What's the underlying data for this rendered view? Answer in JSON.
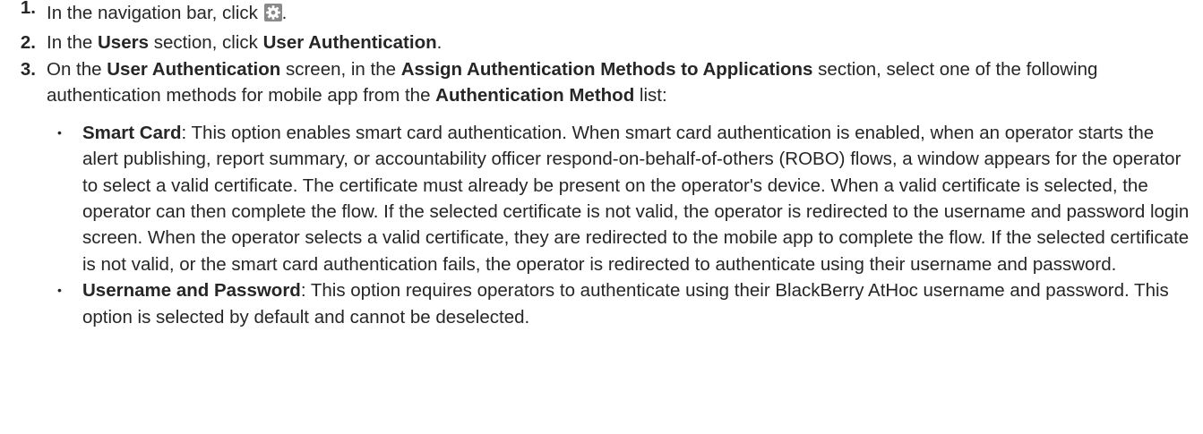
{
  "steps": [
    {
      "number": "1.",
      "text_before": "In the navigation bar, click ",
      "icon": "gear-icon",
      "text_after": "."
    },
    {
      "number": "2.",
      "t1": "In the ",
      "b1": "Users",
      "t2": " section, click ",
      "b2": "User Authentication",
      "t3": "."
    },
    {
      "number": "3.",
      "t1": "On the ",
      "b1": "User Authentication",
      "t2": " screen, in the ",
      "b2": "Assign Authentication Methods to Applications",
      "t3": " section, select one of the following authentication methods for mobile app from the ",
      "b3": "Authentication Method",
      "t4": " list:"
    }
  ],
  "options": [
    {
      "name": "Smart Card",
      "description": ": This option enables smart card authentication. When smart card authentication is enabled, when an operator starts the alert publishing, report summary, or accountability officer respond-on-behalf-of-others (ROBO) flows, a window appears for the operator to select a valid certificate. The certificate must already be present on the operator's device. When a valid certificate is selected, the operator can then complete the flow. If the selected certificate is not valid, the operator is redirected to the username and password login screen. When the operator selects a valid certificate, they are redirected to the mobile app to complete the flow. If the selected certificate is not valid, or the smart card authentication fails, the operator is redirected to authenticate using their username and password."
    },
    {
      "name": "Username and Password",
      "description": ": This option requires operators to authenticate using their BlackBerry AtHoc username and password. This option is selected by default and cannot be deselected."
    }
  ],
  "bullet_char": "•",
  "colors": {
    "text": "#262626",
    "icon_bg": "#8a8a8a",
    "icon_fg": "#ffffff"
  }
}
